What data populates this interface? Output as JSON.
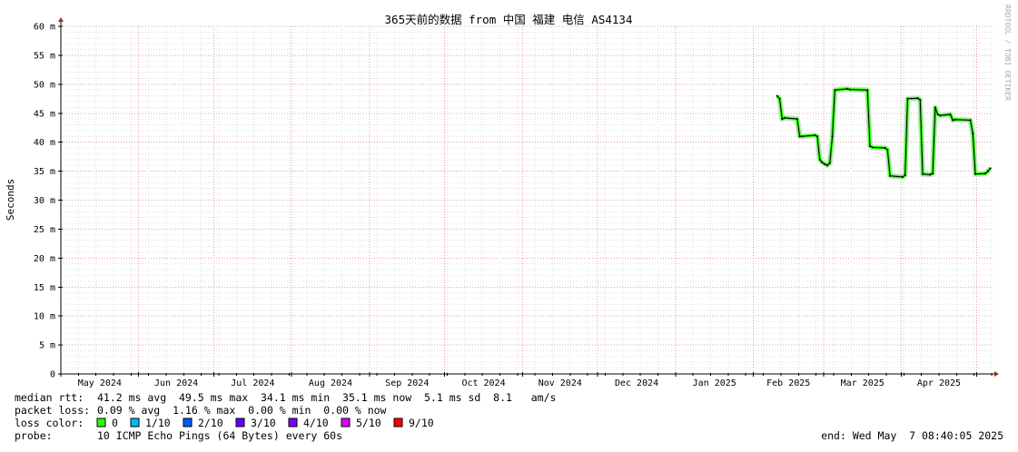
{
  "chart_data": {
    "type": "line",
    "title": "365天前的数据 from 中国 福建 电信 AS4134",
    "ylabel": "Seconds",
    "xlabel": "",
    "ylim": [
      0,
      60
    ],
    "y_unit": "ms",
    "y_ticks": [
      {
        "value": 0,
        "label": "0"
      },
      {
        "value": 5,
        "label": "5 m"
      },
      {
        "value": 10,
        "label": "10 m"
      },
      {
        "value": 15,
        "label": "15 m"
      },
      {
        "value": 20,
        "label": "20 m"
      },
      {
        "value": 25,
        "label": "25 m"
      },
      {
        "value": 30,
        "label": "30 m"
      },
      {
        "value": 35,
        "label": "35 m"
      },
      {
        "value": 40,
        "label": "40 m"
      },
      {
        "value": 45,
        "label": "45 m"
      },
      {
        "value": 50,
        "label": "50 m"
      },
      {
        "value": 55,
        "label": "55 m"
      },
      {
        "value": 60,
        "label": "60 m"
      }
    ],
    "x_range": [
      "2024-05-01",
      "2025-05-07"
    ],
    "x_months": [
      {
        "start": "2024-05-01",
        "label": "May 2024"
      },
      {
        "start": "2024-06-01",
        "label": "Jun 2024"
      },
      {
        "start": "2024-07-01",
        "label": "Jul 2024"
      },
      {
        "start": "2024-08-01",
        "label": "Aug 2024"
      },
      {
        "start": "2024-09-01",
        "label": "Sep 2024"
      },
      {
        "start": "2024-10-01",
        "label": "Oct 2024"
      },
      {
        "start": "2024-11-01",
        "label": "Nov 2024"
      },
      {
        "start": "2024-12-01",
        "label": "Dec 2024"
      },
      {
        "start": "2025-01-01",
        "label": "Jan 2025"
      },
      {
        "start": "2025-02-01",
        "label": "Feb 2025"
      },
      {
        "start": "2025-03-01",
        "label": "Mar 2025"
      },
      {
        "start": "2025-04-01",
        "label": "Apr 2025"
      }
    ],
    "grid": true,
    "series": [
      {
        "name": "median rtt",
        "color": "#000000",
        "x": [
          "2025-02-10",
          "2025-02-11",
          "2025-02-12",
          "2025-02-13",
          "2025-02-18",
          "2025-02-19",
          "2025-02-20",
          "2025-02-25",
          "2025-02-26",
          "2025-02-27",
          "2025-02-28",
          "2025-03-01",
          "2025-03-02",
          "2025-03-03",
          "2025-03-04",
          "2025-03-05",
          "2025-03-10",
          "2025-03-11",
          "2025-03-18",
          "2025-03-19",
          "2025-03-20",
          "2025-03-25",
          "2025-03-26",
          "2025-03-27",
          "2025-04-01",
          "2025-04-02",
          "2025-04-03",
          "2025-04-07",
          "2025-04-08",
          "2025-04-09",
          "2025-04-12",
          "2025-04-13",
          "2025-04-14",
          "2025-04-15",
          "2025-04-16",
          "2025-04-20",
          "2025-04-21",
          "2025-04-22",
          "2025-04-28",
          "2025-04-29",
          "2025-04-30",
          "2025-05-04",
          "2025-05-05",
          "2025-05-06"
        ],
        "y": [
          48.0,
          47.5,
          44.0,
          44.2,
          44.0,
          41.0,
          41.0,
          41.2,
          41.0,
          37.0,
          36.5,
          36.2,
          36.0,
          36.4,
          41.0,
          49.0,
          49.2,
          49.1,
          49.0,
          39.3,
          39.1,
          39.0,
          38.7,
          34.2,
          34.0,
          34.3,
          47.5,
          47.6,
          47.3,
          34.5,
          34.4,
          34.6,
          46.0,
          44.8,
          44.6,
          44.8,
          43.8,
          43.9,
          43.8,
          41.5,
          34.5,
          34.6,
          35.0,
          35.5
        ]
      }
    ],
    "legend": {
      "median_rtt": {
        "label": "median rtt:",
        "text": "41.2 ms avg  49.5 ms max  34.1 ms min  35.1 ms now  5.1 ms sd  8.1   am/s"
      },
      "packet_loss": {
        "label": "packet loss:",
        "text": "0.09 % avg  1.16 % max  0.00 % min  0.00 % now"
      },
      "loss_color_label": "loss color:",
      "loss_colors": [
        {
          "label": "0",
          "color": "#26ff00"
        },
        {
          "label": "1/10",
          "color": "#00b8ff"
        },
        {
          "label": "2/10",
          "color": "#0059ff"
        },
        {
          "label": "3/10",
          "color": "#5e00ff"
        },
        {
          "label": "4/10",
          "color": "#7e00ff"
        },
        {
          "label": "5/10",
          "color": "#dd00ff"
        },
        {
          "label": "9/10",
          "color": "#ff0000"
        }
      ],
      "probe": {
        "label": "probe:",
        "text": "10 ICMP Echo Pings (64 Bytes) every 60s"
      },
      "end": "end: Wed May  7 08:40:05 2025"
    },
    "watermark": "RRDTOOL / TOBI OETIKER",
    "colors": {
      "grid_minor": "#e0e0e0",
      "grid_major": "#e8a0a0",
      "axis": "#000000",
      "arrow": "#a03020"
    }
  }
}
